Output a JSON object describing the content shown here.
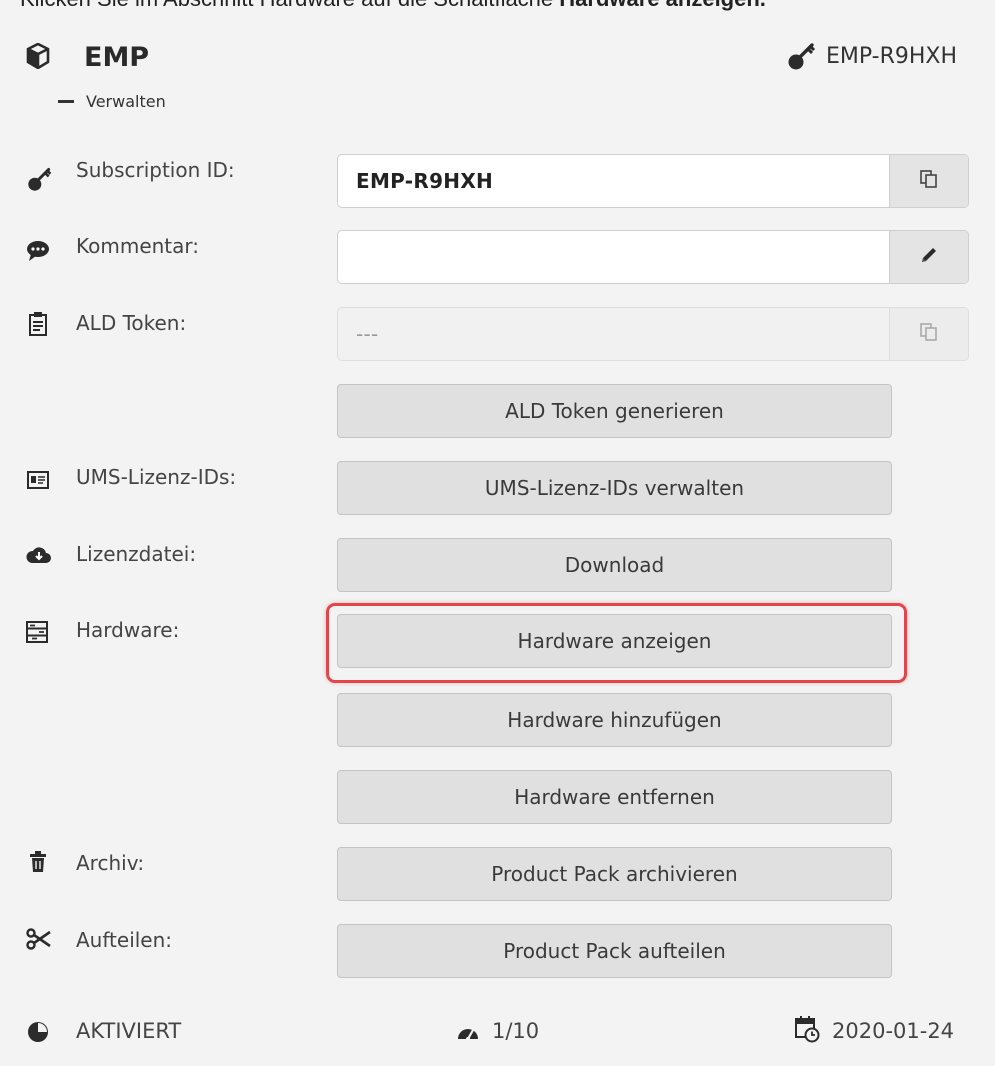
{
  "top_cut_text": {
    "plain": "Klicken Sie im Abschnitt Hardware auf die Schaltfläche ",
    "bold": "Hardware anzeigen."
  },
  "header": {
    "product_name": "EMP",
    "product_icon": "cube-icon",
    "subscription_icon": "key-icon",
    "subscription_id": "EMP-R9HXH",
    "manage_label": "Verwalten"
  },
  "rows": {
    "subscription": {
      "label": "Subscription ID:",
      "value": "EMP-R9HXH",
      "icon": "key-icon",
      "action_icon": "copy-icon"
    },
    "comment": {
      "label": "Kommentar:",
      "value": "",
      "icon": "comment-icon",
      "action_icon": "pencil-icon"
    },
    "ald_token": {
      "label": "ALD Token:",
      "value": "---",
      "icon": "clipboard-icon",
      "action_icon": "copy-icon",
      "disabled": true
    },
    "ald_generate": {
      "button": "ALD Token generieren"
    },
    "ums": {
      "label": "UMS-Lizenz-IDs:",
      "button": "UMS-Lizenz-IDs verwalten",
      "icon": "id-card-icon"
    },
    "license": {
      "label": "Lizenzdatei:",
      "button": "Download",
      "icon": "cloud-download-icon"
    },
    "hardware": {
      "label": "Hardware:",
      "icon": "hardware-list-icon",
      "show_button": "Hardware anzeigen",
      "add_button": "Hardware hinzufügen",
      "remove_button": "Hardware entfernen"
    },
    "archive": {
      "label": "Archiv:",
      "button": "Product Pack archivieren",
      "icon": "trash-icon"
    },
    "split": {
      "label": "Aufteilen:",
      "button": "Product Pack aufteilen",
      "icon": "scissors-icon"
    }
  },
  "footer": {
    "status": "AKTIVIERT",
    "status_icon": "pie-clock-icon",
    "usage": "1/10",
    "usage_icon": "gauge-icon",
    "date": "2020-01-24",
    "date_icon": "calendar-clock-icon"
  },
  "colors": {
    "highlight": "#e0464a",
    "button_bg": "#e0e0e0",
    "page_bg": "#f3f3f3"
  }
}
